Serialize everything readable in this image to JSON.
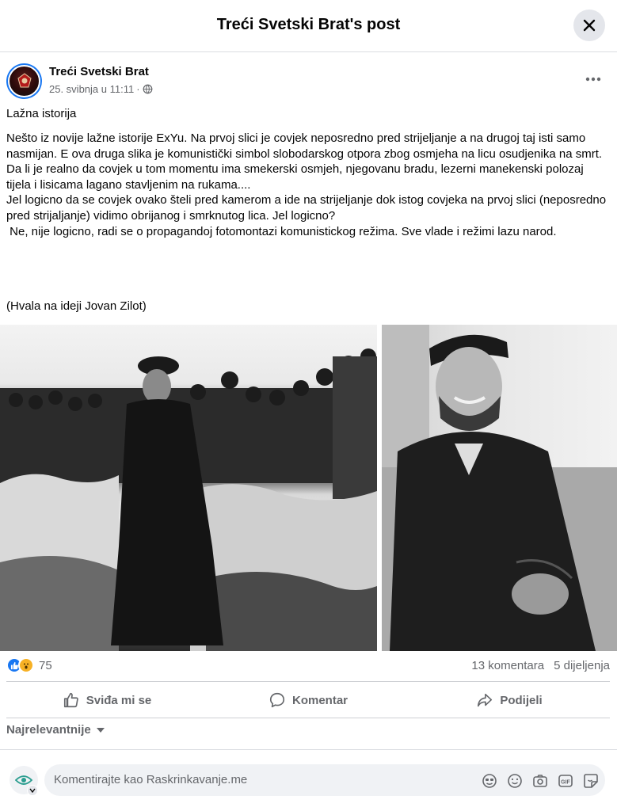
{
  "header": {
    "title": "Treći Svetski Brat's post"
  },
  "post": {
    "author": "Treći Svetski Brat",
    "date": "25. svibnja u 11:11",
    "separator": "·",
    "title": "Lažna istorija",
    "paragraphs": [
      "Nešto iz novije lažne istorije ExYu. Na prvoj slici je covjek neposredno pred strijeljanje a na drugoj taj isti samo nasmijan. E ova druga slika je komunistički simbol slobodarskog otpora zbog osmjeha na licu osudjenika na smrt.",
      "Da li je realno da covjek u tom momentu ima smekerski osmjeh, njegovanu bradu, lezerni manekenski polozaj tijela i lisicama lagano stavljenim na rukama....",
      "Jel logicno da se covjek ovako šteli pred kamerom a ide na strijeljanje dok istog covjeka na prvoj slici (neposredno pred strijaljanje) vidimo obrijanog i smrknutog lica. Jel logicno?",
      " Ne, nije logicno, radi se o propagandoj fotomontazi komunistickog režima. Sve vlade i režimi lazu narod."
    ],
    "credit": "(Hvala na ideji Jovan Zilot)"
  },
  "stats": {
    "reaction_count": "75",
    "comments": "13 komentara",
    "shares": "5 dijeljenja"
  },
  "actions": {
    "like": "Sviđa mi se",
    "comment": "Komentar",
    "share": "Podijeli"
  },
  "sort": {
    "label": "Najrelevantnije"
  },
  "composer": {
    "placeholder": "Komentirajte kao Raskrinkavanje.me"
  },
  "colors": {
    "accent": "#1877f2",
    "wow": "#f7b125",
    "muted": "#65676b"
  }
}
